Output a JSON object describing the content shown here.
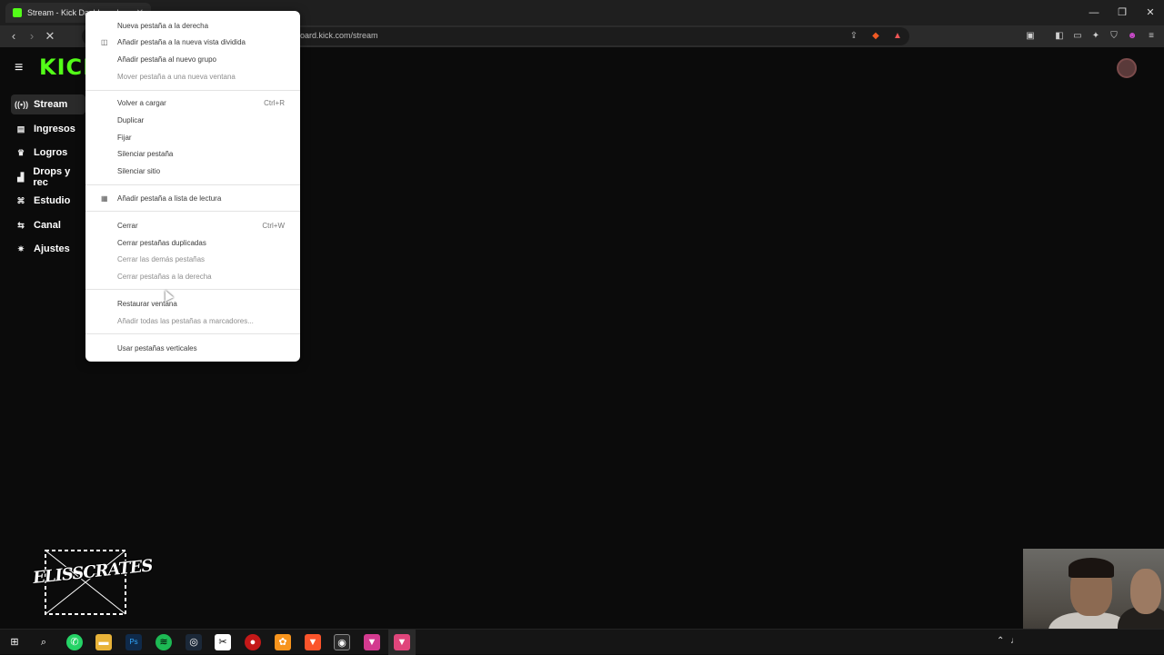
{
  "browser": {
    "tab_title": "Stream - Kick Dashboard",
    "url_visible": "oard.kick.com/stream",
    "icons": [
      "back-icon",
      "forward-icon",
      "stop-loading-icon",
      "share-icon",
      "brave-shield-icon",
      "rewards-icon",
      "tab-search-icon",
      "sidebar-icon",
      "wallet-icon",
      "leo-ai-icon",
      "vpn-icon",
      "profile-icon",
      "menu-icon"
    ],
    "window_controls": {
      "minimize": "—",
      "maximize": "❐",
      "close": "✕"
    }
  },
  "kick": {
    "logo": "KICK",
    "sidebar": [
      {
        "label": "Stream",
        "icon": "stream-icon",
        "glyph": "((•))",
        "active": true
      },
      {
        "label": "Ingresos",
        "icon": "revenue-icon",
        "glyph": "▤"
      },
      {
        "label": "Logros",
        "icon": "trophy-icon",
        "glyph": "♛"
      },
      {
        "label": "Drops y rec",
        "icon": "drops-icon",
        "glyph": "▟"
      },
      {
        "label": "Estudio",
        "icon": "studio-icon",
        "glyph": "⌘"
      },
      {
        "label": "Canal",
        "icon": "channel-icon",
        "glyph": "⇆"
      },
      {
        "label": "Ajustes",
        "icon": "settings-gear-icon",
        "glyph": "✷"
      }
    ]
  },
  "context_menu": {
    "items": [
      {
        "label": "Nueva pestaña a la derecha"
      },
      {
        "label": "Añadir pestaña a la nueva vista dividida",
        "icon": "split-view-icon"
      },
      {
        "label": "Añadir pestaña al nuevo grupo"
      },
      {
        "label": "Mover pestaña a una nueva ventana",
        "disabled": true
      },
      {
        "label": "Volver a cargar",
        "shortcut": "Ctrl+R"
      },
      {
        "label": "Duplicar"
      },
      {
        "label": "Fijar"
      },
      {
        "label": "Silenciar pestaña"
      },
      {
        "label": "Silenciar sitio"
      },
      {
        "label": "Añadir pestaña a lista de lectura",
        "icon": "reading-list-icon"
      },
      {
        "label": "Cerrar",
        "shortcut": "Ctrl+W"
      },
      {
        "label": "Cerrar pestañas duplicadas"
      },
      {
        "label": "Cerrar las demás pestañas",
        "disabled": true
      },
      {
        "label": "Cerrar pestañas a la derecha",
        "disabled": true
      },
      {
        "label": "Restaurar ventana"
      },
      {
        "label": "Añadir todas las pestañas a marcadores...",
        "disabled": true
      },
      {
        "label": "Usar pestañas verticales"
      }
    ]
  },
  "overlay": {
    "logo_text": "ELISSCRATES"
  },
  "taskbar": {
    "apps": [
      "windows-start-icon",
      "search-icon",
      "whatsapp-icon",
      "file-explorer-icon",
      "photoshop-icon",
      "spotify-icon",
      "steam-icon",
      "capcut-icon",
      "obs-record-icon",
      "fl-studio-icon",
      "brave-icon",
      "kick-app-icon",
      "brave-beta-icon",
      "brave-active-icon"
    ],
    "tray": [
      "chevron-up-icon",
      "microphone-icon"
    ]
  },
  "colors": {
    "kick_green": "#53fc18",
    "menu_bg": "#ffffff",
    "page_bg": "#0b0b0b"
  }
}
